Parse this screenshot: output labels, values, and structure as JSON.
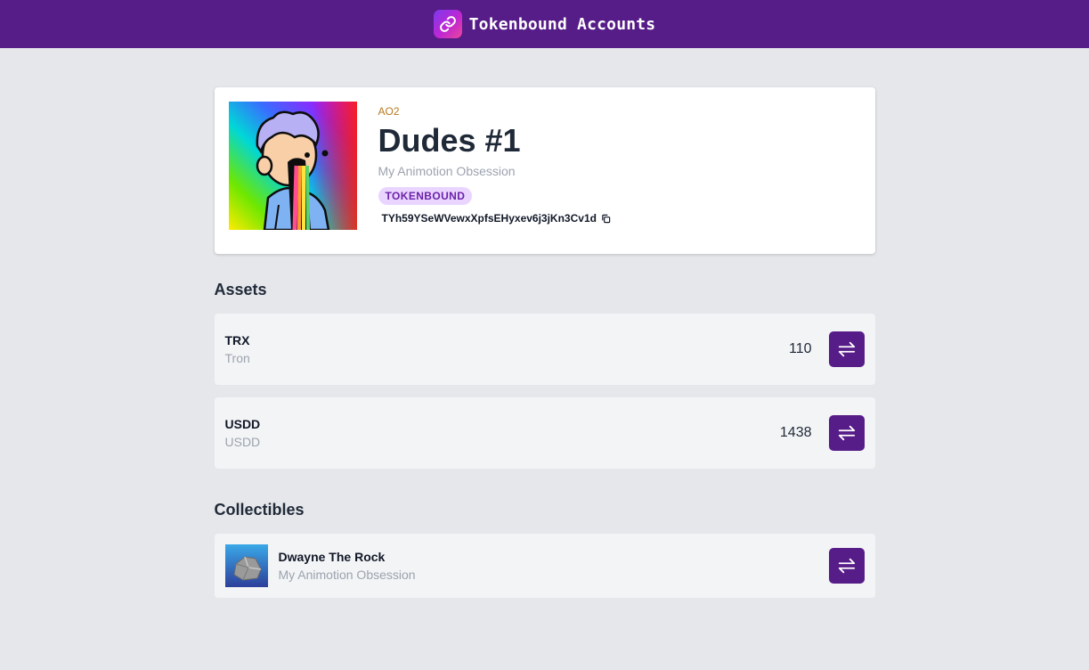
{
  "header": {
    "title": "Tokenbound Accounts",
    "logo_icon": "chain-link-icon"
  },
  "nft": {
    "collection_tag": "AO2",
    "title": "Dudes #1",
    "collection_name": "My Animotion Obsession",
    "badge": "TOKENBOUND",
    "address": "TYh59YSeWVewxXpfsEHyxev6j3jKn3Cv1d",
    "copy_icon": "copy-icon"
  },
  "assets": {
    "title": "Assets",
    "items": [
      {
        "symbol": "TRX",
        "name": "Tron",
        "amount": "110"
      },
      {
        "symbol": "USDD",
        "name": "USDD",
        "amount": "1438"
      }
    ]
  },
  "collectibles": {
    "title": "Collectibles",
    "items": [
      {
        "name": "Dwayne The Rock",
        "collection": "My Animotion Obsession"
      }
    ]
  },
  "colors": {
    "header_bg": "#561c87",
    "accent": "#561c87",
    "badge_bg": "#e9d5ff",
    "badge_text": "#6b21a8",
    "collection_tag": "#b7791f",
    "page_bg": "#e5e7eb"
  },
  "icons": {
    "transfer": "transfer-arrows-icon"
  }
}
